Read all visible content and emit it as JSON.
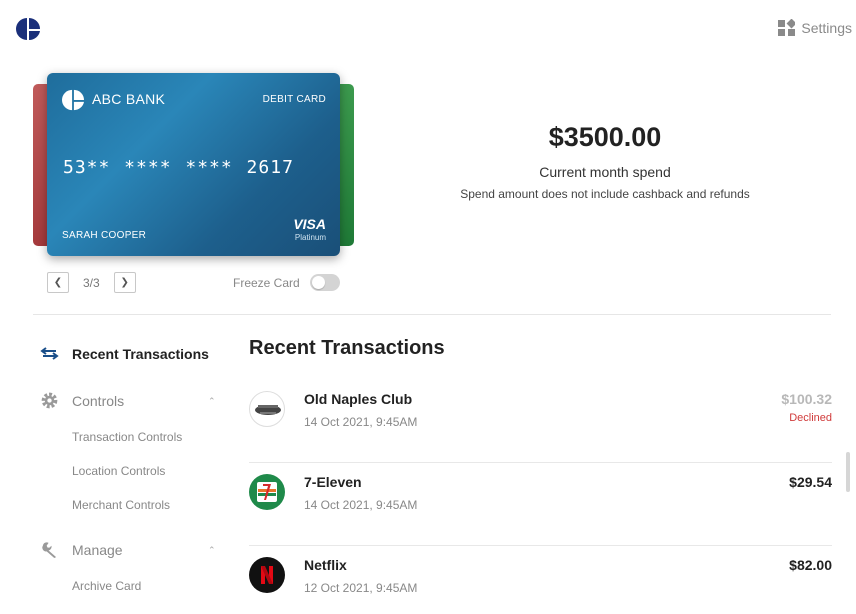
{
  "header": {
    "settings_label": "Settings"
  },
  "card": {
    "bank_name": "ABC BANK",
    "card_type": "DEBIT CARD",
    "number": "53** **** **** 2617",
    "holder": "SARAH COOPER",
    "network": "VISA",
    "tier": "Platinum"
  },
  "pager": {
    "label": "3/3"
  },
  "freeze": {
    "label": "Freeze Card",
    "enabled": false
  },
  "spend": {
    "amount": "$3500.00",
    "label": "Current month spend",
    "note": "Spend amount does not include cashback and refunds"
  },
  "sidebar": {
    "recent": "Recent Transactions",
    "controls": "Controls",
    "controls_items": [
      "Transaction Controls",
      "Location Controls",
      "Merchant Controls"
    ],
    "manage": "Manage",
    "manage_items": [
      "Archive Card"
    ]
  },
  "transactions": {
    "title": "Recent Transactions",
    "items": [
      {
        "name": "Old Naples Club",
        "date": "14 Oct 2021, 9:45AM",
        "amount": "$100.32",
        "status": "Declined"
      },
      {
        "name": "7-Eleven",
        "date": "14 Oct 2021, 9:45AM",
        "amount": "$29.54",
        "status": ""
      },
      {
        "name": "Netflix",
        "date": "12 Oct 2021, 9:45AM",
        "amount": "$82.00",
        "status": ""
      }
    ]
  },
  "colors": {
    "accent": "#1a4f8a",
    "declined": "#d03a3a",
    "card_blue": "#1f6d9c"
  }
}
